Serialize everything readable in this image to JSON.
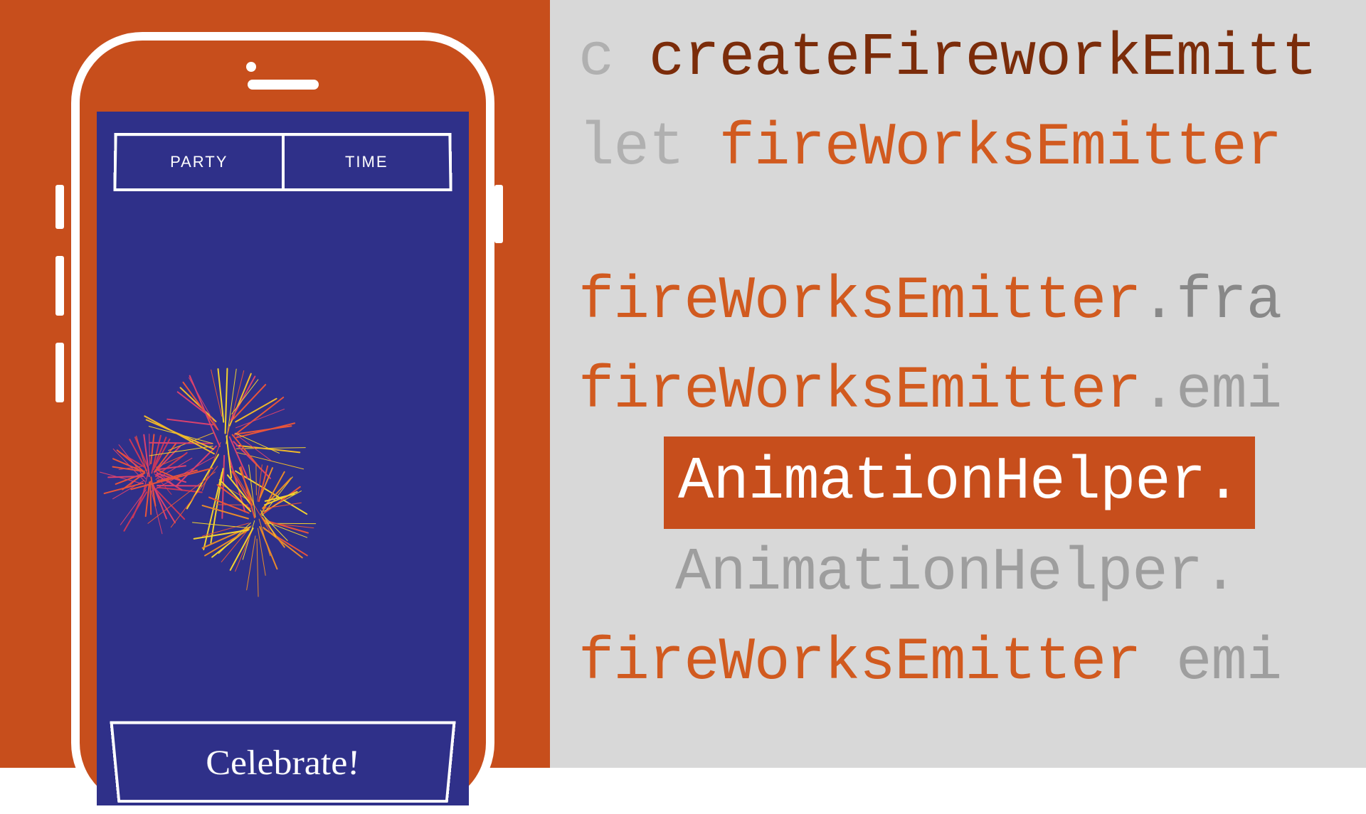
{
  "phone": {
    "tab1": "PARTY",
    "tab2": "TIME",
    "button": "Celebrate!"
  },
  "code": {
    "line1_prefix": "c ",
    "line1_main": "createFireworkEmitt",
    "line2_kw": "let ",
    "line2_main": "fireWorksEmitter",
    "line3_main": "fireWorksEmitter",
    "line3_suffix": ".fra",
    "line4_main": "fireWorksEmitter",
    "line4_suffix": ".emi",
    "line5_highlight": "AnimationHelper.",
    "line6_main": "AnimationHelper",
    "line6_suffix": ".",
    "line7_main": "fireWorksEmitter",
    "line7_suffix": " emi"
  }
}
